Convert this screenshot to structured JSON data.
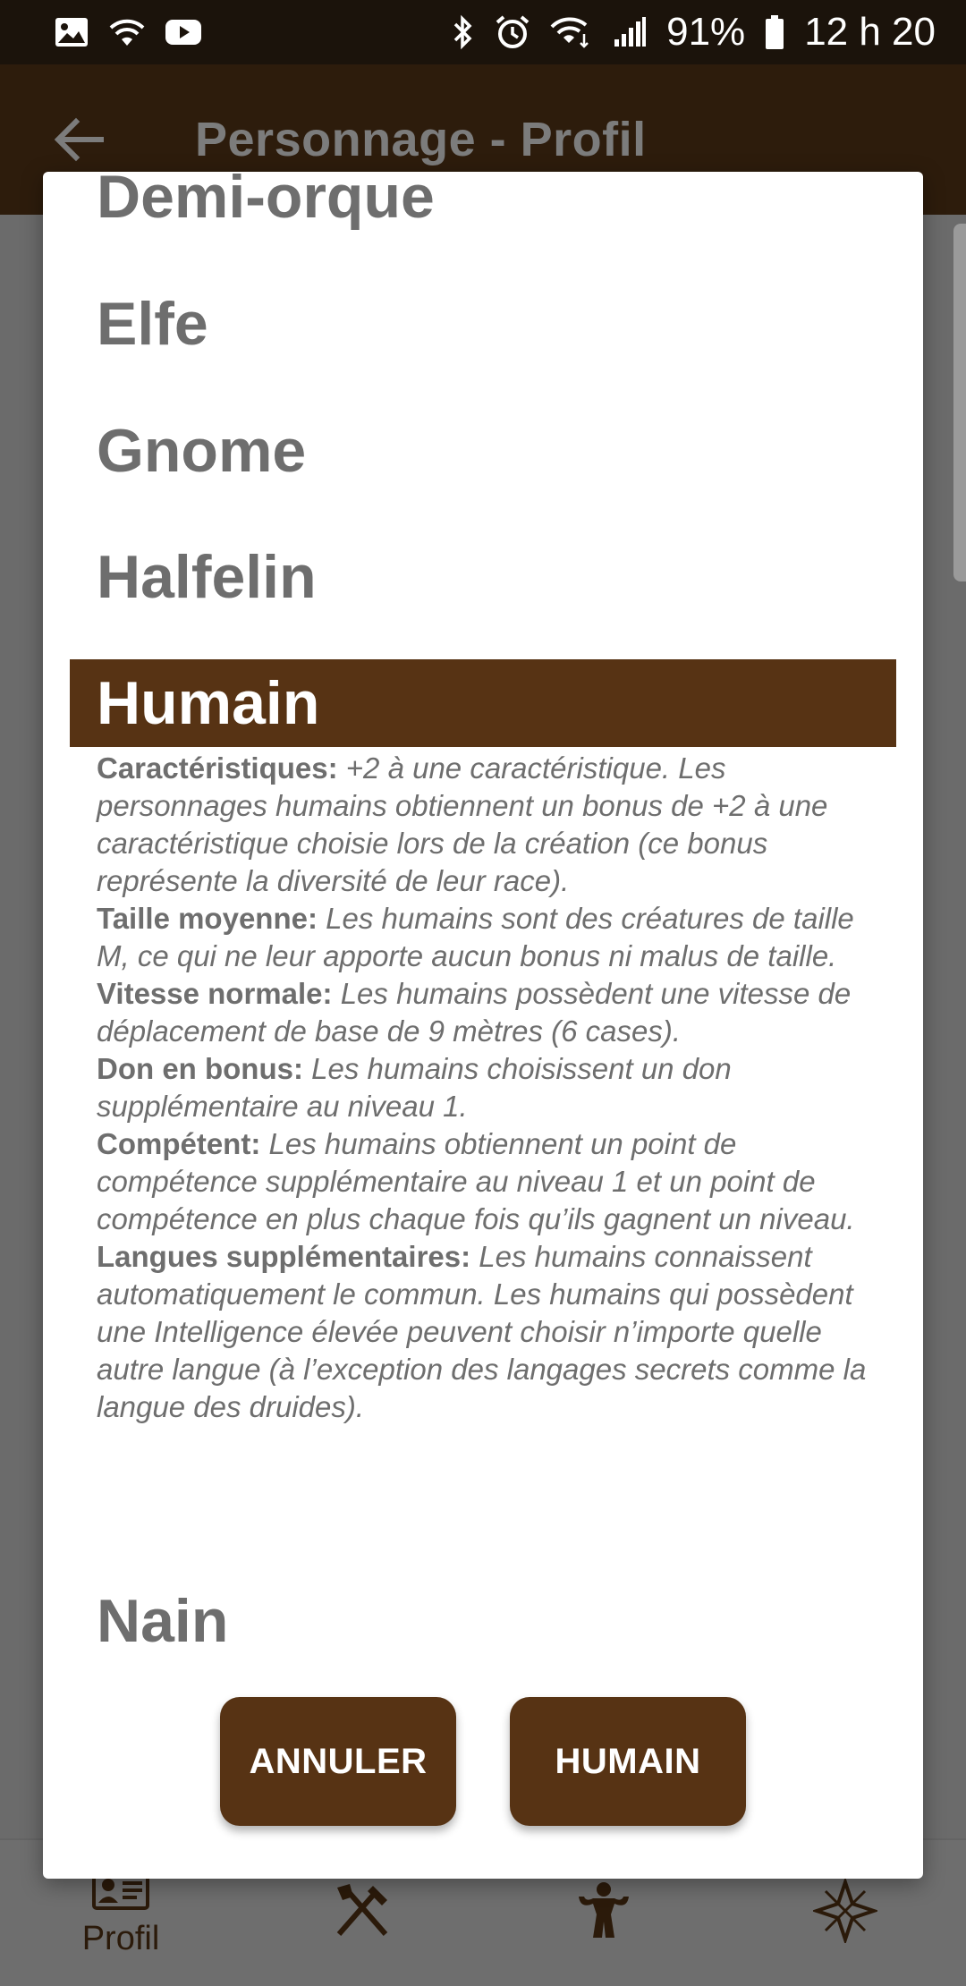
{
  "status_bar": {
    "battery": "91%",
    "time": "12 h 20"
  },
  "app_bar": {
    "title": "Personnage - Profil"
  },
  "bottom_nav": {
    "items": [
      {
        "label": "Profil",
        "icon": "profile-card-icon"
      },
      {
        "label": "",
        "icon": "crossed-tools-icon"
      },
      {
        "label": "",
        "icon": "strongman-icon"
      },
      {
        "label": "",
        "icon": "star-icon"
      }
    ]
  },
  "dialog": {
    "races": [
      "Demi-orque",
      "Elfe",
      "Gnome",
      "Halfelin"
    ],
    "selected_race": "Humain",
    "next_race": "Nain",
    "traits": [
      {
        "name": "Caractéristiques:",
        "text": " +2 à une caractéristique. Les personnages humains obtiennent un bonus de +2 à une caractéristique choisie lors de la création (ce bonus représente la diversité de leur race)."
      },
      {
        "name": "Taille moyenne:",
        "text": " Les humains sont des créatures de taille M, ce qui ne leur apporte aucun bonus ni malus de taille."
      },
      {
        "name": "Vitesse normale:",
        "text": " Les humains possèdent une vitesse de déplacement de base de 9 mètres (6 cases)."
      },
      {
        "name": "Don en bonus:",
        "text": " Les humains choisissent un don supplémentaire au niveau 1."
      },
      {
        "name": "Compétent:",
        "text": " Les humains obtiennent un point de compétence supplémentaire au niveau 1 et un point de compétence en plus chaque fois qu’ils gagnent un niveau."
      },
      {
        "name": "Langues supplémentaires:",
        "text": " Les humains connaissent automatiquement le commun. Les humains qui possèdent une Intelligence élevée peuvent choisir n’importe quelle autre langue (à l’exception des langages secrets comme la langue des druides)."
      }
    ],
    "cancel_label": "ANNULER",
    "confirm_label": "HUMAIN"
  },
  "colors": {
    "accent": "#573314",
    "status_bar": "#1b130b",
    "dialog_bg": "#ffffff",
    "muted_text": "#6e6e6e"
  }
}
